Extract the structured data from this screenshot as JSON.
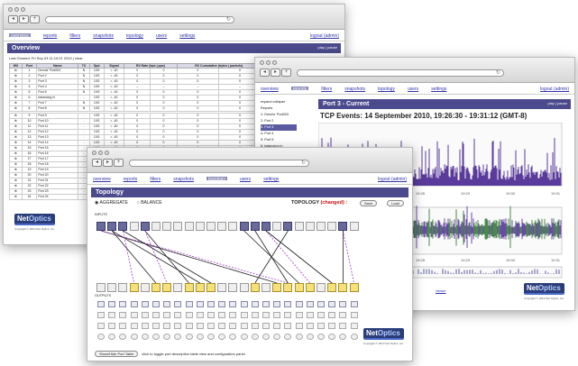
{
  "overview_window": {
    "nav": [
      "overview",
      "reports",
      "filters",
      "snapshots",
      "topology",
      "users",
      "settings"
    ],
    "logout": "logout (admin)",
    "panel_title": "Overview",
    "panel_actions": "play | pause",
    "last_cleared": "Last Cleared: Fri Sep 03 11:10:21 2010 | clear",
    "columns": [
      "W/I",
      "Port",
      "Name",
      "TX",
      "Spd",
      "Signal",
      "RX Rate (bps | pps)",
      "RX Cumulative (bytes | packets)"
    ],
    "rows_a": [
      [
        "1",
        "Dennis' Pod003",
        "N",
        "10G",
        "< -40",
        "0",
        "0",
        "0",
        "0"
      ],
      [
        "2",
        "Port 2",
        "N",
        "10G",
        "< -40",
        "0",
        "0",
        "0",
        "0"
      ],
      [
        "3",
        "Port 3",
        "N",
        "10G",
        "< -40",
        "0",
        "0",
        "0",
        "0"
      ],
      [
        "4",
        "Port 4",
        "N",
        "10G",
        "< -40",
        "--",
        "--",
        "--",
        "--"
      ],
      [
        "5",
        "Port 5",
        "N",
        "10G",
        "< -40",
        "0",
        "0",
        "0",
        "0"
      ],
      [
        "6",
        "balancing in",
        "-",
        "10G",
        "< -40",
        "0",
        "0",
        "0",
        "0"
      ],
      [
        "7",
        "Port 7",
        "N",
        "10G",
        "< -40",
        "0",
        "0",
        "0",
        "0"
      ],
      [
        "8",
        "Port 8",
        "N",
        "10G",
        "< -40",
        "0",
        "0",
        "0",
        "0"
      ]
    ],
    "rows_b": [
      [
        "9",
        "Port 9",
        "-",
        "10G",
        "< -40",
        "0",
        "0",
        "0",
        "0"
      ],
      [
        "10",
        "Port 10",
        "-",
        "10G",
        "< -40",
        "0",
        "0",
        "0",
        "0"
      ],
      [
        "11",
        "Port 11",
        "-",
        "10G",
        "< -40",
        "0",
        "0",
        "0",
        "0"
      ],
      [
        "12",
        "Port 12",
        "-",
        "10G",
        "< -40",
        "0",
        "0",
        "0",
        "0"
      ],
      [
        "13",
        "Port 13",
        "-",
        "10G",
        "< -40",
        "0",
        "0",
        "0",
        "0"
      ],
      [
        "14",
        "Port 14",
        "-",
        "10G",
        "< -40",
        "0",
        "0",
        "0",
        "0"
      ],
      [
        "15",
        "Port 15",
        "-",
        "10G",
        "< -40",
        "0",
        "0",
        "0",
        "0"
      ],
      [
        "16",
        "Port 16",
        "-",
        "10G",
        "< -40",
        "0",
        "0",
        "0",
        "0"
      ],
      [
        "17",
        "Port 17",
        "-",
        "10G",
        "< -40",
        "0",
        "0",
        "0",
        "0"
      ],
      [
        "18",
        "Port 18",
        "-",
        "10G",
        "< -40",
        "0",
        "0",
        "0",
        "0"
      ],
      [
        "19",
        "Port 19",
        "-",
        "10G",
        "< -40",
        "0",
        "0",
        "0",
        "0"
      ],
      [
        "20",
        "Port 20",
        "-",
        "10G",
        "< -40",
        "0",
        "0",
        "0",
        "0"
      ],
      [
        "21",
        "Port 21",
        "-",
        "10G",
        "< -40",
        "0",
        "0",
        "0",
        "0"
      ],
      [
        "22",
        "Port 22",
        "-",
        "10G",
        "< -40",
        "0",
        "0",
        "0",
        "0"
      ],
      [
        "23",
        "Port 23",
        "-",
        "10G",
        "< -40",
        "0",
        "0",
        "0",
        "0"
      ],
      [
        "24",
        "Port 24",
        "-",
        "10G",
        "< -40",
        "0",
        "0",
        "0",
        "0"
      ]
    ]
  },
  "report_window": {
    "nav": [
      "overview",
      "reports",
      "filters",
      "snapshots",
      "topology",
      "users",
      "settings"
    ],
    "logout": "logout (admin)",
    "sidebar_toggle": "expand collapse",
    "sidebar_items": [
      "Reports",
      "1: Dennis' Pod003",
      "2: Port 2",
      "3: Port 3",
      "4: Port 4",
      "5: Port 5",
      "6: balancing in"
    ],
    "panel_title": "Port 3 - Current",
    "panel_actions": "play | pause",
    "graph_title": "TCP Events: 14 September 2010, 19:26:30 - 19:31:12 (GMT-8)",
    "time_ticks": [
      "19:26",
      "19:27",
      "19:28",
      "19:29",
      "19:30",
      "19:31"
    ],
    "footer_link": "viewer"
  },
  "topology_window": {
    "nav": [
      "overview",
      "reports",
      "filters",
      "snapshots",
      "topology",
      "users",
      "settings"
    ],
    "logout": "logout (admin)",
    "panel_title": "Topology",
    "mode_aggregate": "AGGREGATE",
    "mode_balance": "BALANCE",
    "topology_label": "TOPOLOGY",
    "changed": "(changed) :",
    "save": "Save",
    "load": "Load",
    "inputs_label": "INPUTS",
    "outputs_label": "OUTPUTS",
    "active_inputs": [
      "1",
      "2",
      "3",
      "5",
      "14",
      "15",
      "16",
      "18",
      "23"
    ],
    "active_outputs": [
      "4",
      "6",
      "7",
      "9",
      "10",
      "11",
      "15",
      "17",
      "18",
      "19",
      "20",
      "22",
      "23",
      "24"
    ],
    "show_hide": "Show/Hide Port Table",
    "show_hide_hint": "click to toggle port description table view and configuration panel"
  },
  "brand": {
    "logo_net": "Net",
    "logo_optics": "Optics",
    "copyright": "Copyright © 2010 Net Optics, Inc."
  },
  "colors": {
    "accent": "#4a4a8c",
    "changed": "#cc1111",
    "plot": "#5a3a9a"
  }
}
